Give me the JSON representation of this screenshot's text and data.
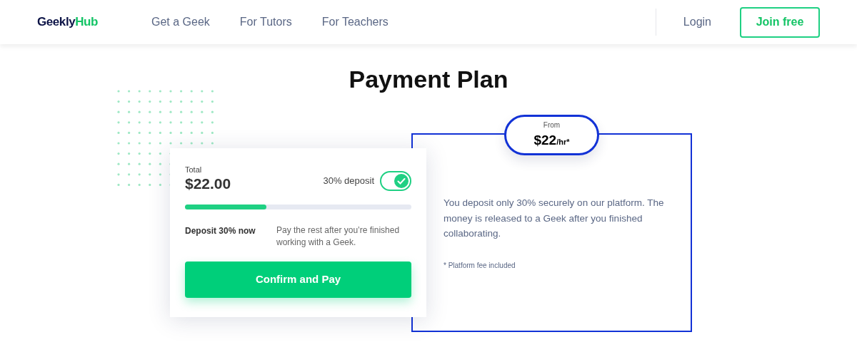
{
  "logo": {
    "primary": "Geekly",
    "accent": "Hub"
  },
  "nav": [
    "Get a Geek",
    "For Tutors",
    "For Teachers"
  ],
  "login": "Login",
  "join": "Join free",
  "title": "Payment Plan",
  "card": {
    "total_label": "Total",
    "total": "$22.00",
    "toggle": {
      "label": "30% deposit",
      "on": true
    },
    "progress": {
      "level": 0.36
    },
    "deposit_label": "Deposit 30% now",
    "deposit_note": "Pay the rest after you’re finished working with a Geek.",
    "button": "Confirm and Pay"
  },
  "info": {
    "from": "From",
    "price": "$22",
    "unit": "/hr*",
    "text": "You deposit only 30% securely on our platform. The money is released to a Geek after you finished collaborating.",
    "footnote": "* Platform fee included"
  }
}
